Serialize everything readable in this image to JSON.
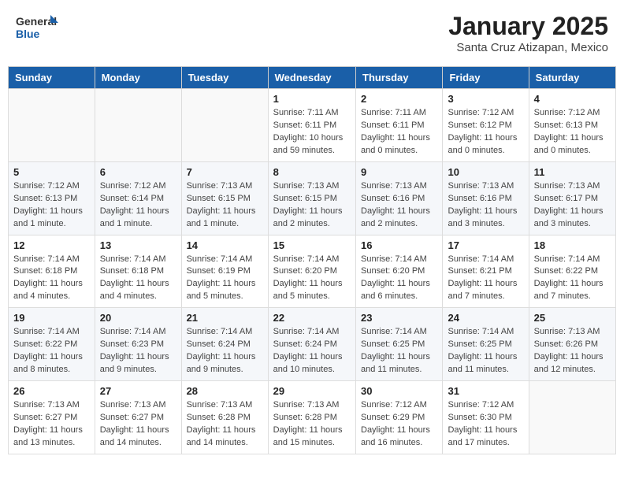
{
  "header": {
    "logo_general": "General",
    "logo_blue": "Blue",
    "month_title": "January 2025",
    "location": "Santa Cruz Atizapan, Mexico"
  },
  "weekdays": [
    "Sunday",
    "Monday",
    "Tuesday",
    "Wednesday",
    "Thursday",
    "Friday",
    "Saturday"
  ],
  "weeks": [
    [
      {
        "day": "",
        "info": ""
      },
      {
        "day": "",
        "info": ""
      },
      {
        "day": "",
        "info": ""
      },
      {
        "day": "1",
        "info": "Sunrise: 7:11 AM\nSunset: 6:11 PM\nDaylight: 10 hours and 59 minutes."
      },
      {
        "day": "2",
        "info": "Sunrise: 7:11 AM\nSunset: 6:11 PM\nDaylight: 11 hours and 0 minutes."
      },
      {
        "day": "3",
        "info": "Sunrise: 7:12 AM\nSunset: 6:12 PM\nDaylight: 11 hours and 0 minutes."
      },
      {
        "day": "4",
        "info": "Sunrise: 7:12 AM\nSunset: 6:13 PM\nDaylight: 11 hours and 0 minutes."
      }
    ],
    [
      {
        "day": "5",
        "info": "Sunrise: 7:12 AM\nSunset: 6:13 PM\nDaylight: 11 hours and 1 minute."
      },
      {
        "day": "6",
        "info": "Sunrise: 7:12 AM\nSunset: 6:14 PM\nDaylight: 11 hours and 1 minute."
      },
      {
        "day": "7",
        "info": "Sunrise: 7:13 AM\nSunset: 6:15 PM\nDaylight: 11 hours and 1 minute."
      },
      {
        "day": "8",
        "info": "Sunrise: 7:13 AM\nSunset: 6:15 PM\nDaylight: 11 hours and 2 minutes."
      },
      {
        "day": "9",
        "info": "Sunrise: 7:13 AM\nSunset: 6:16 PM\nDaylight: 11 hours and 2 minutes."
      },
      {
        "day": "10",
        "info": "Sunrise: 7:13 AM\nSunset: 6:16 PM\nDaylight: 11 hours and 3 minutes."
      },
      {
        "day": "11",
        "info": "Sunrise: 7:13 AM\nSunset: 6:17 PM\nDaylight: 11 hours and 3 minutes."
      }
    ],
    [
      {
        "day": "12",
        "info": "Sunrise: 7:14 AM\nSunset: 6:18 PM\nDaylight: 11 hours and 4 minutes."
      },
      {
        "day": "13",
        "info": "Sunrise: 7:14 AM\nSunset: 6:18 PM\nDaylight: 11 hours and 4 minutes."
      },
      {
        "day": "14",
        "info": "Sunrise: 7:14 AM\nSunset: 6:19 PM\nDaylight: 11 hours and 5 minutes."
      },
      {
        "day": "15",
        "info": "Sunrise: 7:14 AM\nSunset: 6:20 PM\nDaylight: 11 hours and 5 minutes."
      },
      {
        "day": "16",
        "info": "Sunrise: 7:14 AM\nSunset: 6:20 PM\nDaylight: 11 hours and 6 minutes."
      },
      {
        "day": "17",
        "info": "Sunrise: 7:14 AM\nSunset: 6:21 PM\nDaylight: 11 hours and 7 minutes."
      },
      {
        "day": "18",
        "info": "Sunrise: 7:14 AM\nSunset: 6:22 PM\nDaylight: 11 hours and 7 minutes."
      }
    ],
    [
      {
        "day": "19",
        "info": "Sunrise: 7:14 AM\nSunset: 6:22 PM\nDaylight: 11 hours and 8 minutes."
      },
      {
        "day": "20",
        "info": "Sunrise: 7:14 AM\nSunset: 6:23 PM\nDaylight: 11 hours and 9 minutes."
      },
      {
        "day": "21",
        "info": "Sunrise: 7:14 AM\nSunset: 6:24 PM\nDaylight: 11 hours and 9 minutes."
      },
      {
        "day": "22",
        "info": "Sunrise: 7:14 AM\nSunset: 6:24 PM\nDaylight: 11 hours and 10 minutes."
      },
      {
        "day": "23",
        "info": "Sunrise: 7:14 AM\nSunset: 6:25 PM\nDaylight: 11 hours and 11 minutes."
      },
      {
        "day": "24",
        "info": "Sunrise: 7:14 AM\nSunset: 6:25 PM\nDaylight: 11 hours and 11 minutes."
      },
      {
        "day": "25",
        "info": "Sunrise: 7:13 AM\nSunset: 6:26 PM\nDaylight: 11 hours and 12 minutes."
      }
    ],
    [
      {
        "day": "26",
        "info": "Sunrise: 7:13 AM\nSunset: 6:27 PM\nDaylight: 11 hours and 13 minutes."
      },
      {
        "day": "27",
        "info": "Sunrise: 7:13 AM\nSunset: 6:27 PM\nDaylight: 11 hours and 14 minutes."
      },
      {
        "day": "28",
        "info": "Sunrise: 7:13 AM\nSunset: 6:28 PM\nDaylight: 11 hours and 14 minutes."
      },
      {
        "day": "29",
        "info": "Sunrise: 7:13 AM\nSunset: 6:28 PM\nDaylight: 11 hours and 15 minutes."
      },
      {
        "day": "30",
        "info": "Sunrise: 7:12 AM\nSunset: 6:29 PM\nDaylight: 11 hours and 16 minutes."
      },
      {
        "day": "31",
        "info": "Sunrise: 7:12 AM\nSunset: 6:30 PM\nDaylight: 11 hours and 17 minutes."
      },
      {
        "day": "",
        "info": ""
      }
    ]
  ]
}
